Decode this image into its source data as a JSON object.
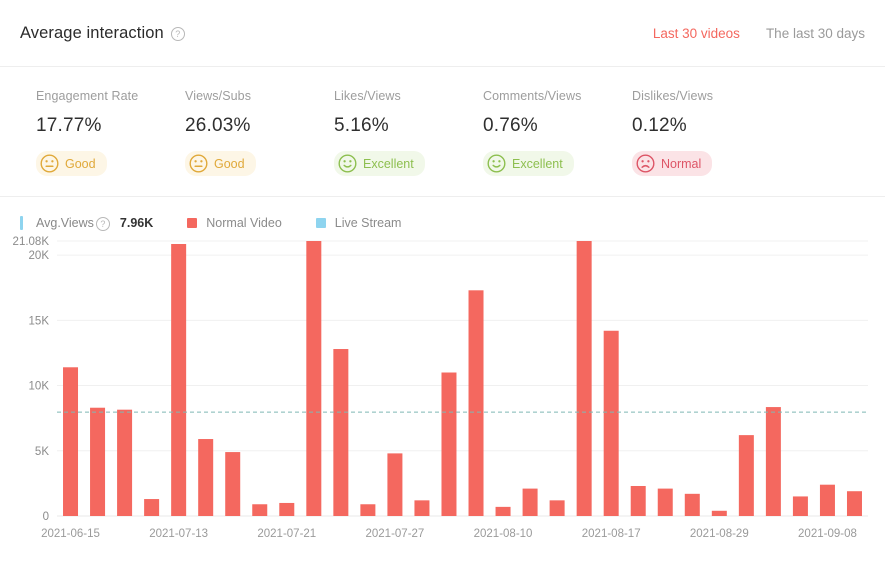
{
  "header": {
    "title": "Average interaction",
    "help_icon": "question-mark-icon",
    "tabs": [
      {
        "label": "Last 30 videos",
        "active": true
      },
      {
        "label": "The last 30 days",
        "active": false
      }
    ]
  },
  "metrics": [
    {
      "label": "Engagement Rate",
      "value": "17.77%",
      "rating": "Good",
      "rating_class": "good",
      "face": "neutral-face-icon",
      "color": "#e0a93a"
    },
    {
      "label": "Views/Subs",
      "value": "26.03%",
      "rating": "Good",
      "rating_class": "good",
      "face": "neutral-face-icon",
      "color": "#e0a93a"
    },
    {
      "label": "Likes/Views",
      "value": "5.16%",
      "rating": "Excellent",
      "rating_class": "excellent",
      "face": "smiley-face-icon",
      "color": "#8dbf4f"
    },
    {
      "label": "Comments/Views",
      "value": "0.76%",
      "rating": "Excellent",
      "rating_class": "excellent",
      "face": "smiley-face-icon",
      "color": "#8dbf4f"
    },
    {
      "label": "Dislikes/Views",
      "value": "0.12%",
      "rating": "Normal",
      "rating_class": "normal",
      "face": "sad-face-icon",
      "color": "#dd5566"
    }
  ],
  "legend": {
    "avg_label": "Avg.Views",
    "avg_help_icon": "question-mark-icon",
    "avg_value": "7.96K",
    "items": [
      {
        "label": "Normal Video",
        "color": "#f4685f"
      },
      {
        "label": "Live Stream",
        "color": "#8ed4ef"
      }
    ]
  },
  "chart_data": {
    "type": "bar",
    "title": "Average interaction",
    "xlabel": "",
    "ylabel": "",
    "ylim": [
      0,
      21080
    ],
    "grid": true,
    "legend_position": "top-left",
    "ytick_labels": [
      "0",
      "5K",
      "10K",
      "15K",
      "20K",
      "21.08K"
    ],
    "ytick_values": [
      0,
      5000,
      10000,
      15000,
      20000,
      21080
    ],
    "xtick_labels": [
      "2021-06-15",
      "2021-07-13",
      "2021-07-21",
      "2021-07-27",
      "2021-08-10",
      "2021-08-17",
      "2021-08-29",
      "2021-09-08"
    ],
    "xtick_indices": [
      0,
      4,
      8,
      12,
      16,
      20,
      24,
      28
    ],
    "average_line": {
      "label": "Avg.Views",
      "value": 7960,
      "display": "7.96K",
      "color": "#7fb8b5"
    },
    "series": [
      {
        "name": "Normal Video",
        "color": "#f4685f",
        "values": [
          11400,
          8300,
          8150,
          1300,
          20850,
          5900,
          4900,
          900,
          1000,
          21080,
          12800,
          900,
          4800,
          1200,
          11000,
          17300,
          700,
          2100,
          1200,
          21080,
          14200,
          2300,
          2100,
          1700,
          400,
          6200,
          8350,
          1500,
          2400,
          1900
        ]
      },
      {
        "name": "Live Stream",
        "color": "#8ed4ef",
        "values": []
      }
    ]
  }
}
